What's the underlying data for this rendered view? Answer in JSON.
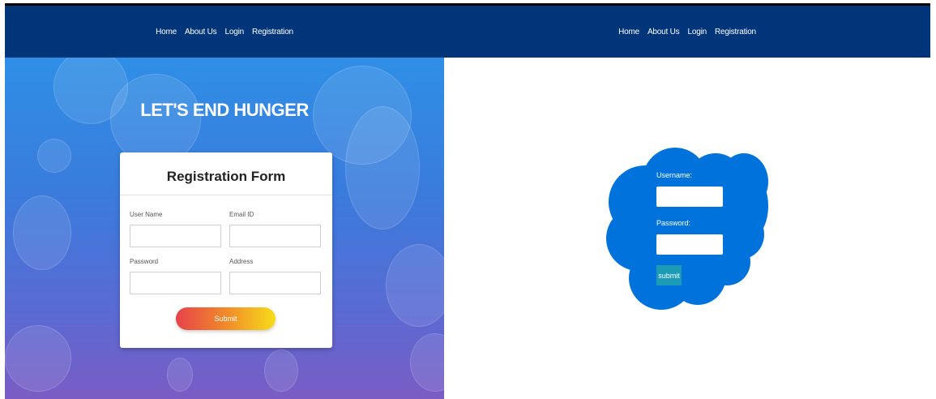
{
  "left_page": {
    "nav": [
      "Home",
      "About Us",
      "Login",
      "Registration"
    ],
    "hero_title": "LET'S END HUNGER",
    "form": {
      "title": "Registration Form",
      "user_name_label": "User Name",
      "email_label": "Email ID",
      "password_label": "Password",
      "address_label": "Address",
      "submit_label": "Submit"
    }
  },
  "right_page": {
    "nav": [
      "Home",
      "About Us",
      "Login",
      "Registration"
    ],
    "login": {
      "username_label": "Username:",
      "password_label": "Password:",
      "submit_label": "submit"
    }
  },
  "colors": {
    "nav_bg": "#01357a",
    "cloud": "#0072db",
    "submit_button": "#1c9bb6"
  }
}
